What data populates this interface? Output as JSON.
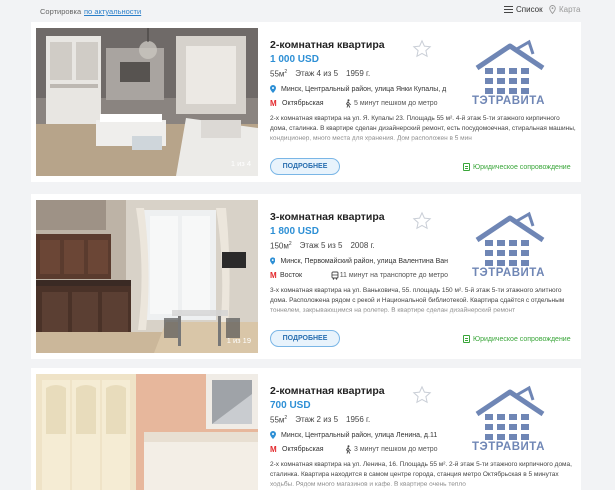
{
  "topbar": {
    "sort_label": "Сортировка",
    "sort_value": "по актуальности",
    "view_list": "Список",
    "view_map": "Карта"
  },
  "listings": [
    {
      "title": "2-комнатная квартира",
      "price": "1 000 USD",
      "area": "55м",
      "floor": "Этаж 4 из 5",
      "year": "1959 г.",
      "address": "Минск, Центральный район, улица Янки Купалы, д",
      "metro": "Октябрьская",
      "transport_time": "5 минут пешком до метро",
      "description": "2-х комнатная квартира на ул. Я. Купалы 23. Площадь 55 м². 4-й этаж 5-ти этажного кирпичного дома, сталинка. В квартире сделан дизайнерский ремонт, есть посудомоечная, стиральная машины, кондиционер, много места для хранения. Дом расположен в 5 мин",
      "photo_counter": "1 из 4",
      "more_label": "ПОДРОБНЕЕ",
      "agency": "ТЭТРАВИТА",
      "legal_label": "Юридическое сопровождение"
    },
    {
      "title": "3-комнатная квартира",
      "price": "1 800 USD",
      "area": "150м",
      "floor": "Этаж 5 из 5",
      "year": "2008 г.",
      "address": "Минск, Первомайский район, улица Валентина Ван",
      "metro": "Восток",
      "transport_time": "11 минут на транспорте до метро",
      "description": "3-х комнатная квартира на ул. Ваньковича, 55. площадь 150 м². 5-й этаж 5-ти этажного элитного дома. Расположена рядом с рекой и Национальной библиотекой. Квартира сдаётся с отдельным тоннелем, закрывающимся на ролетер. В квартире сделан дизайнерский ремонт",
      "photo_counter": "1 из 19",
      "more_label": "ПОДРОБНЕЕ",
      "agency": "ТЭТРАВИТА",
      "legal_label": "Юридическое сопровождение"
    },
    {
      "title": "2-комнатная квартира",
      "price": "700 USD",
      "area": "55м",
      "floor": "Этаж 2 из 5",
      "year": "1956 г.",
      "address": "Минск, Центральный район, улица Ленина, д.11",
      "metro": "Октябрьская",
      "transport_time": "3 минут пешком до метро",
      "description": "2-х комнатная квартира на ул. Ленина, 16. Площадь 55 м². 2-й этаж 5-ти этажного кирпичного дома, сталинка. Квартира находится в самом центре города, станция метро Октябрьская в 5 минутах ходьбы. Рядом много магазинов и кафе. В квартире очень тепло",
      "photo_counter": "",
      "more_label": "ПОДРОБНЕЕ",
      "agency": "ТЭТРАВИТА",
      "legal_label": "Юридическое сопровождение"
    }
  ],
  "icons": {
    "location": "map-pin-icon",
    "metro": "metro-icon",
    "walk": "walk-icon",
    "bus": "bus-icon",
    "favorite": "star-icon"
  },
  "colors": {
    "price": "#2d8fd5",
    "agency": "#6f86b5",
    "legal": "#3aa63a",
    "metro": "#e3292d"
  }
}
